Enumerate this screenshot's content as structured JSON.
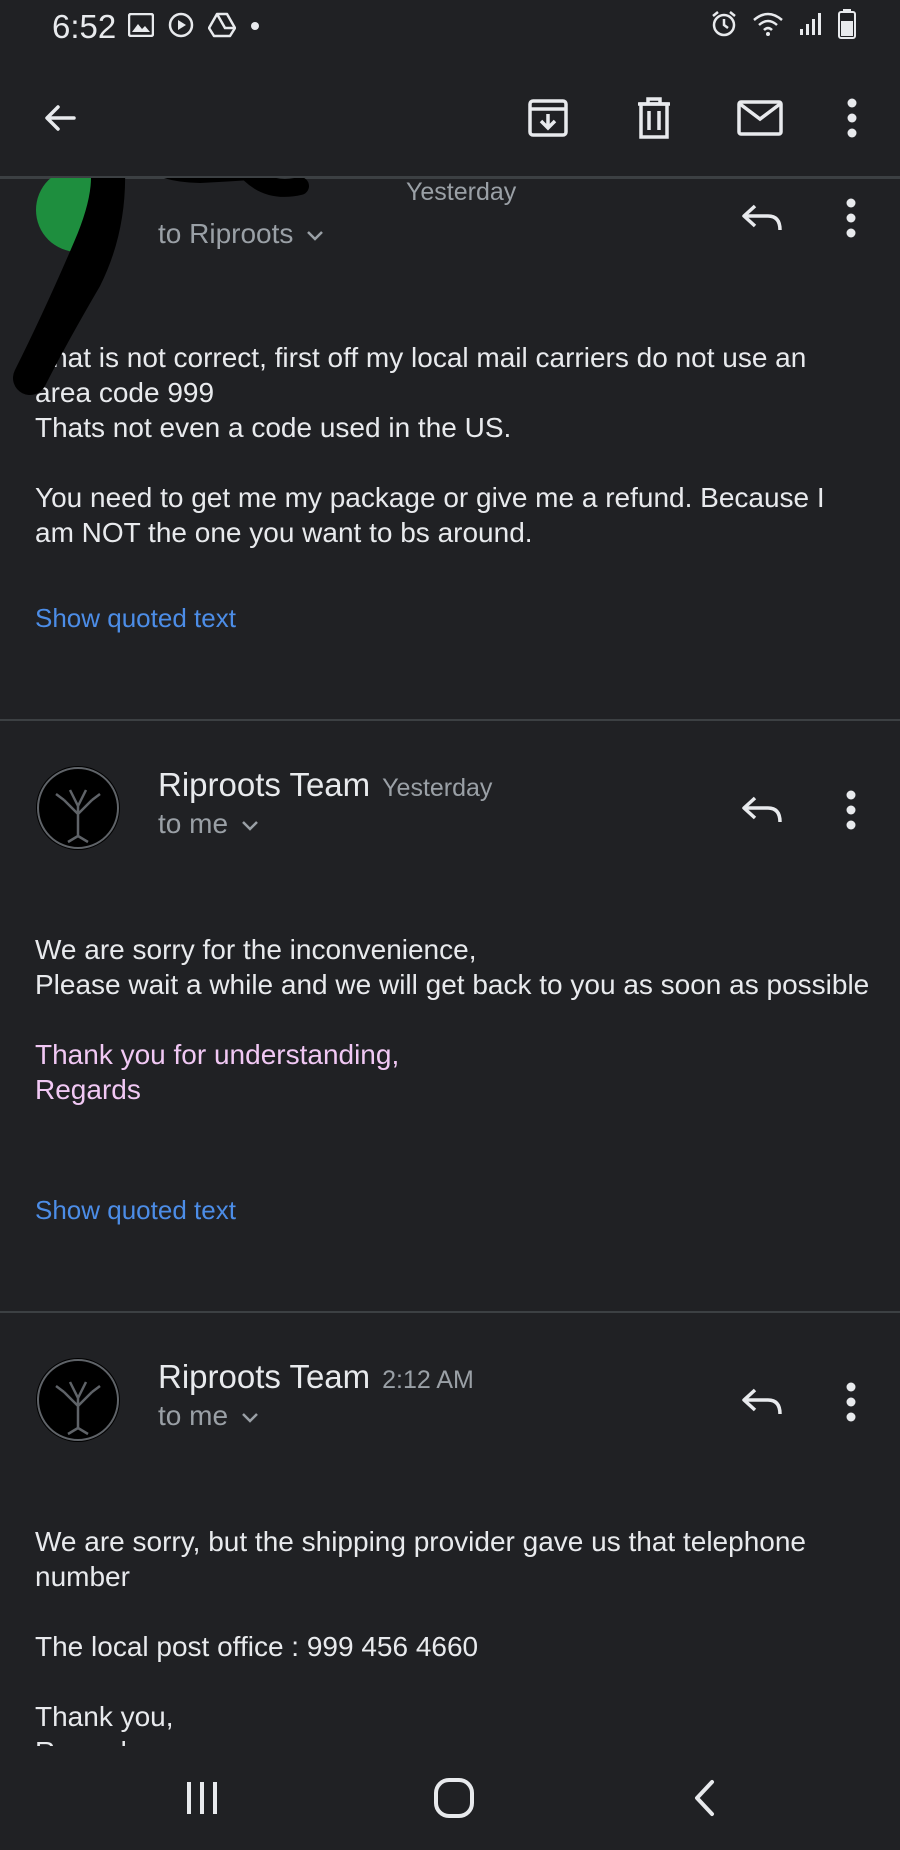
{
  "status_bar": {
    "time": "6:52",
    "left_icons": [
      "gallery-icon",
      "play-icon",
      "drive-icon",
      "dot-icon"
    ],
    "right_icons": [
      "alarm-icon",
      "wifi-icon",
      "signal-icon",
      "battery-icon"
    ]
  },
  "toolbar": {
    "actions": [
      "back-arrow-icon",
      "archive-icon",
      "delete-icon",
      "mark-unread-icon",
      "more-vert-icon"
    ]
  },
  "messages": [
    {
      "sender": "",
      "time": "Yesterday",
      "recipient": "to Riproots",
      "avatar_color": "#1e8e3e",
      "body": [
        "That is not correct, first off my local mail carriers do not use an area code 999",
        "Thats not even a code used in the US.",
        "You need to get me my package or give me a refund. Because I am NOT the one you want to bs around."
      ],
      "show_quoted": "Show quoted text"
    },
    {
      "sender": "Riproots Team",
      "time": "Yesterday",
      "recipient": "to me",
      "body": [
        "We are sorry for the inconvenience,",
        "Please wait a while and we will get back to you as soon as possible"
      ],
      "signature": [
        "Thank you for understanding,",
        "Regards"
      ],
      "show_quoted": "Show quoted text"
    },
    {
      "sender": "Riproots Team",
      "time": "2:12 AM",
      "recipient": "to me",
      "body": [
        "We are sorry, but the shipping provider gave us that telephone number",
        "The local post office : 999 456 4660",
        "Thank you,",
        "Regards,"
      ]
    }
  ],
  "colors": {
    "background": "#202124",
    "text": "#e8eaed",
    "secondary_text": "#9aa0a6",
    "link": "#4c8de7",
    "signature": "#f1c8f4"
  },
  "nav_bar": {
    "buttons": [
      "recents-icon",
      "home-icon",
      "back-icon"
    ]
  }
}
